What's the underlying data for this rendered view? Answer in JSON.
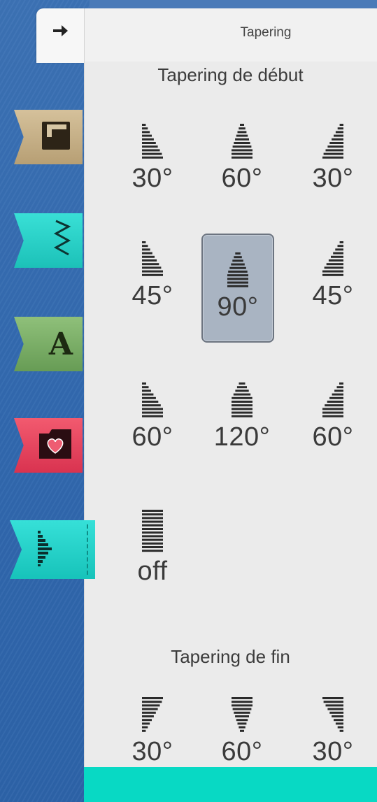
{
  "header": {
    "title": "Tapering"
  },
  "sections": {
    "start_title": "Tapering de début",
    "end_title": "Tapering de fin"
  },
  "start_options": [
    {
      "label": "30°",
      "icon": "taper-left-30-icon"
    },
    {
      "label": "60°",
      "icon": "taper-center-60-icon"
    },
    {
      "label": "30°",
      "icon": "taper-right-30-icon"
    },
    {
      "label": "45°",
      "icon": "taper-left-45-icon"
    },
    {
      "label": "90°",
      "icon": "taper-center-90-icon",
      "selected": true
    },
    {
      "label": "45°",
      "icon": "taper-right-45-icon"
    },
    {
      "label": "60°",
      "icon": "taper-left-60-icon"
    },
    {
      "label": "120°",
      "icon": "taper-center-120-icon"
    },
    {
      "label": "60°",
      "icon": "taper-right-60-icon"
    },
    {
      "label": "off",
      "icon": "taper-off-icon"
    }
  ],
  "end_options": [
    {
      "label": "30°",
      "icon": "taper-end-left-30-icon"
    },
    {
      "label": "60°",
      "icon": "taper-end-center-60-icon"
    },
    {
      "label": "30°",
      "icon": "taper-end-right-30-icon"
    }
  ],
  "side_tabs": [
    {
      "icon": "pattern-folder-icon",
      "color": "#c9b48a"
    },
    {
      "icon": "stitch-zigzag-icon",
      "color": "#2ed3ca"
    },
    {
      "icon": "font-A-icon",
      "letter": "A",
      "color": "#7eb068"
    },
    {
      "icon": "heart-folder-icon",
      "color": "#e84660"
    },
    {
      "icon": "tapering-icon",
      "color": "#22d0c8"
    }
  ],
  "colors": {
    "accent_teal": "#08d9c4",
    "selected_bg": "#a9b4c2",
    "panel_bg": "#ebebeb"
  }
}
